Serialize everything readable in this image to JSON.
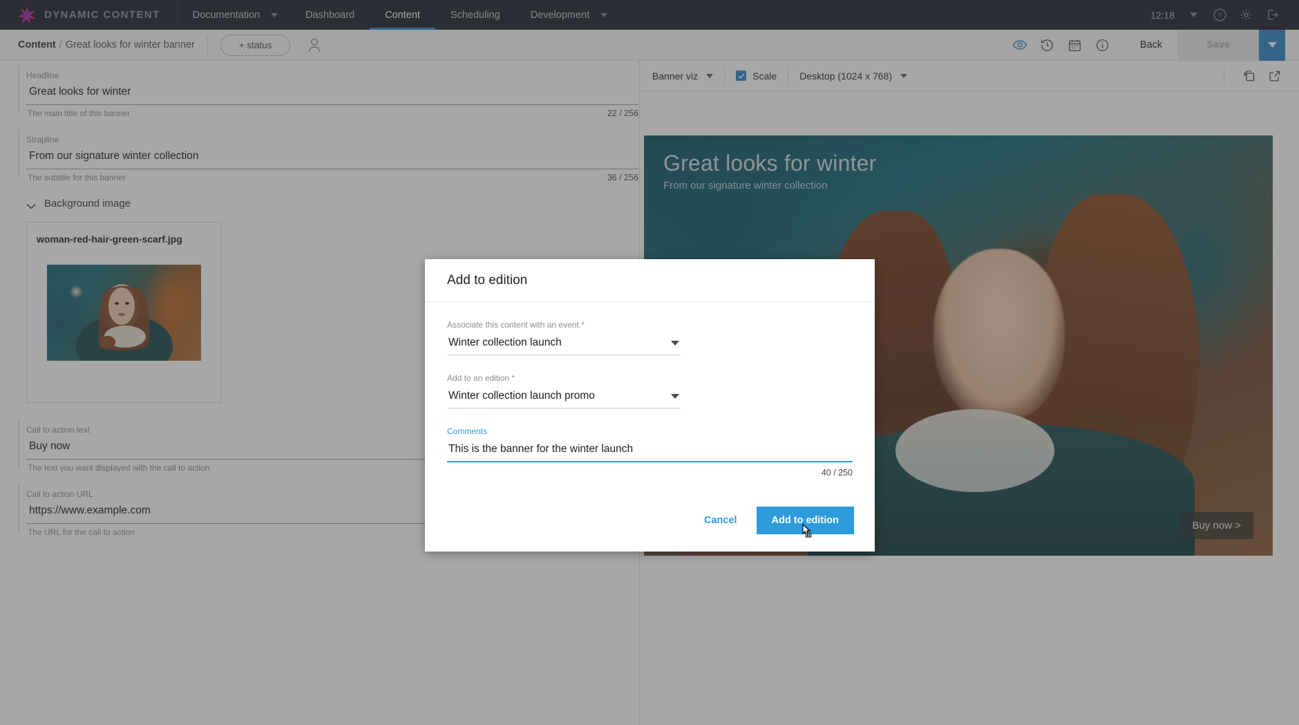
{
  "brand": {
    "name": "DYNAMIC CONTENT",
    "logo_icon": "star-burst-logo-icon"
  },
  "topnav": {
    "items": [
      {
        "label": "Documentation",
        "caret": true,
        "active": false
      },
      {
        "label": "Dashboard",
        "caret": false,
        "active": false
      },
      {
        "label": "Content",
        "caret": false,
        "active": true
      },
      {
        "label": "Scheduling",
        "caret": false,
        "active": false
      },
      {
        "label": "Development",
        "caret": true,
        "active": false
      }
    ],
    "clock": "12:18",
    "icons": [
      "help-icon",
      "gear-icon",
      "logout-icon"
    ],
    "active_color": "#2e87c8"
  },
  "subheader": {
    "breadcrumb_root": "Content",
    "breadcrumb_sep": "/",
    "breadcrumb_leaf": "Great looks for winter banner",
    "status_label": "+ status",
    "avatar_icon": "user-avatar-icon",
    "icons": [
      "eye-preview-icon",
      "history-clock-icon",
      "calendar-icon",
      "info-icon"
    ],
    "back_label": "Back",
    "save_label": "Save",
    "save_caret_icon": "chevron-down-icon"
  },
  "form": {
    "fields": [
      {
        "label": "Headline",
        "value": "Great looks for winter",
        "hint": "The main title of this banner",
        "count": "22 / 256"
      },
      {
        "label": "Strapline",
        "value": "From our signature winter collection",
        "hint": "The subtitle for this banner",
        "count": "36 / 256"
      }
    ],
    "section": {
      "label": "Background image",
      "chevron_icon": "chevron-down-icon"
    },
    "image_card": {
      "filename": "woman-red-hair-green-scarf.jpg"
    },
    "fields2": [
      {
        "label": "Call to action text",
        "value": "Buy now",
        "hint": "The text you want displayed with the call to action"
      },
      {
        "label": "Call to action URL",
        "value": "https://www.example.com",
        "hint": "The URL for the call to action"
      }
    ]
  },
  "preview": {
    "toolbar": {
      "viz_label": "Banner viz",
      "scale_label": "Scale",
      "scale_checked": true,
      "device_label": "Desktop (1024 x 768)",
      "icons": [
        "refresh-frame-icon",
        "open-external-icon"
      ]
    },
    "banner": {
      "headline": "Great looks for winter",
      "strapline": "From our signature winter collection",
      "cta": "Buy now >"
    }
  },
  "modal": {
    "title": "Add to edition",
    "event_field": {
      "label": "Associate this content with an event *",
      "value": "Winter collection launch",
      "caret_icon": "chevron-down-icon"
    },
    "edition_field": {
      "label": "Add to an edition *",
      "value": "Winter collection launch promo",
      "caret_icon": "chevron-down-icon"
    },
    "comments_field": {
      "label": "Comments",
      "value": "This is the banner for the winter launch",
      "count": "40 / 250"
    },
    "cancel_label": "Cancel",
    "submit_label": "Add to edition",
    "accent_color": "#2e9bdc"
  }
}
